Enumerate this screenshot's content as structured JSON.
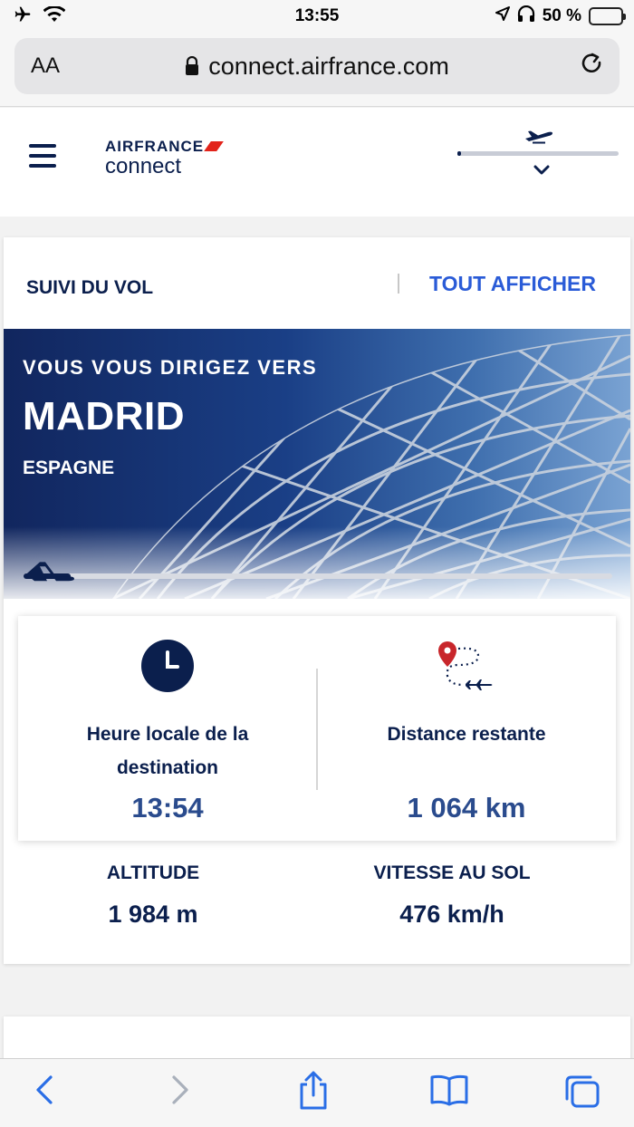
{
  "status_bar": {
    "time": "13:55",
    "battery": "50 %",
    "battery_level": 0.5
  },
  "browser": {
    "text_size_label": "AA",
    "domain": "connect.airfrance.com"
  },
  "header": {
    "brand_top": "AIRFRANCE",
    "brand_bottom": "connect",
    "flight_progress": 0.02
  },
  "flight_tracking": {
    "section_title": "SUIVI DU VOL",
    "show_all_label": "TOUT AFFICHER",
    "heading_to": "VOUS VOUS DIRIGEZ VERS",
    "destination_city": "MADRID",
    "destination_country": "ESPAGNE",
    "route_progress": 0.08,
    "local_time_label": "Heure locale de la destination",
    "local_time_value": "13:54",
    "distance_label": "Distance restante",
    "distance_value": "1 064 km",
    "altitude_label": "ALTITUDE",
    "altitude_value": "1 984 m",
    "speed_label": "VITESSE AU SOL",
    "speed_value": "476 km/h"
  },
  "colors": {
    "navy": "#0b1f4d",
    "link_blue": "#2a5bd7",
    "value_blue": "#2a4b8d",
    "brand_red": "#e2231a"
  }
}
